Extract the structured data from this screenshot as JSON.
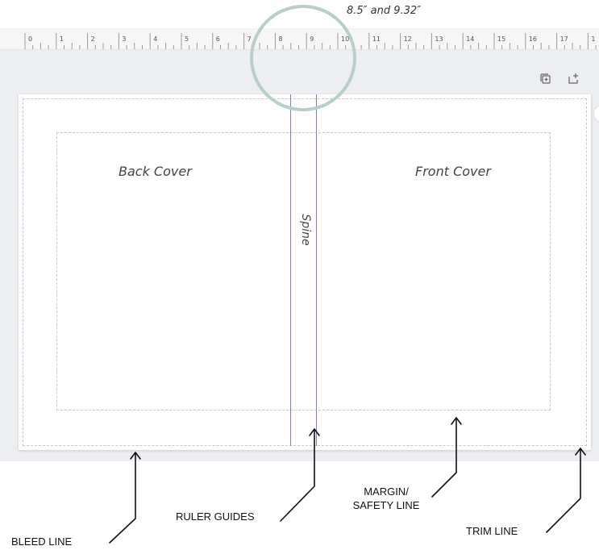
{
  "annotation": {
    "spine_positions": "8.5″ and 9.32″"
  },
  "ruler": {
    "ticks": [
      "0",
      "1",
      "2",
      "3",
      "4",
      "5",
      "6",
      "7",
      "8",
      "9",
      "10",
      "11",
      "12",
      "13",
      "14",
      "15",
      "16",
      "17",
      "1"
    ]
  },
  "toolbar": {
    "duplicate_icon": "duplicate-page-icon",
    "add_icon": "add-page-icon"
  },
  "canvas": {
    "back_cover": "Back Cover",
    "front_cover": "Front Cover",
    "spine": "Spine"
  },
  "callouts": {
    "bleed": "BLEED LINE",
    "ruler_guides": "RULER GUIDES",
    "margin_line1": "MARGIN/",
    "margin_line2": "SAFETY LINE",
    "trim": "TRIM LINE"
  },
  "colors": {
    "guide": "#8080b8",
    "highlight_circle": "#b9cec4",
    "workarea": "#eceef2"
  }
}
